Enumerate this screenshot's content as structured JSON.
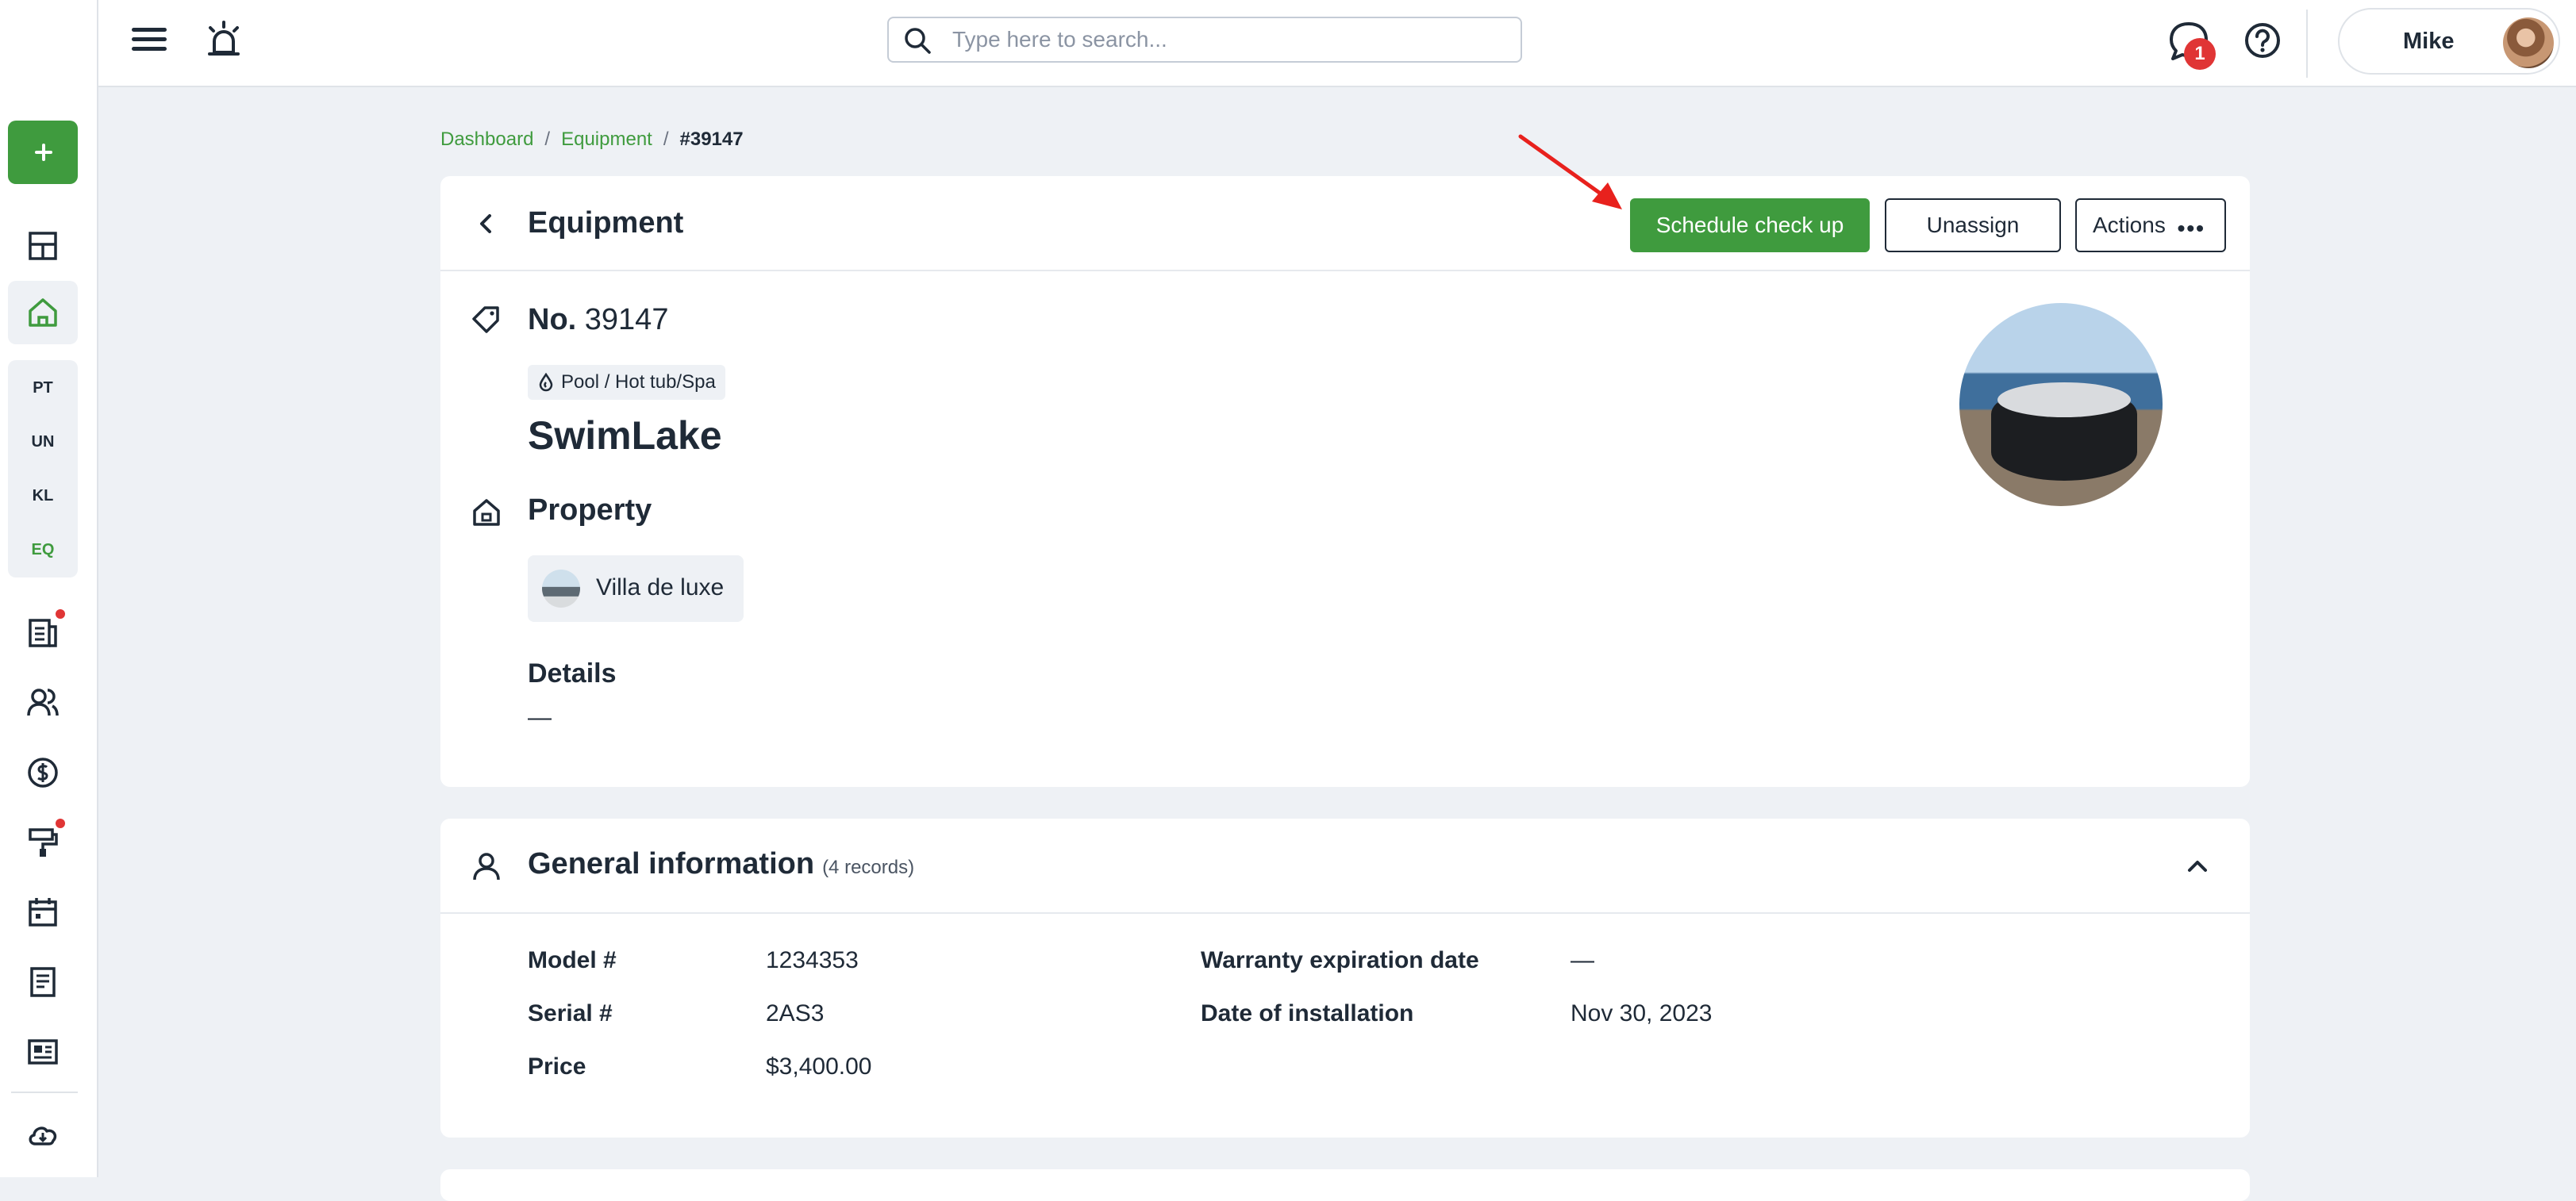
{
  "header": {
    "search_placeholder": "Type here to search...",
    "notification_count": "1",
    "user_name": "Mike"
  },
  "sidebar": {
    "sub_items": [
      "PT",
      "UN",
      "KL",
      "EQ"
    ],
    "active_sub_item": "EQ"
  },
  "breadcrumb": {
    "items": [
      "Dashboard",
      "Equipment"
    ],
    "current": "#39147"
  },
  "equipment_card": {
    "title": "Equipment",
    "schedule_label": "Schedule check up",
    "unassign_label": "Unassign",
    "actions_label": "Actions",
    "number_prefix": "No.",
    "number": "39147",
    "type": "Pool / Hot tub/Spa",
    "name": "SwimLake",
    "property_label": "Property",
    "property_name": "Villa de luxe",
    "details_label": "Details",
    "details_value": "—"
  },
  "general_info": {
    "title": "General information",
    "count": "(4 records)",
    "fields": [
      {
        "label": "Model #",
        "value": "1234353"
      },
      {
        "label": "Serial #",
        "value": "2AS3"
      },
      {
        "label": "Price",
        "value": "$3,400.00"
      },
      {
        "label": "Warranty expiration date",
        "value": "—"
      },
      {
        "label": "Date of installation",
        "value": "Nov 30, 2023"
      }
    ]
  },
  "colors": {
    "brand_green": "#3f9b3e",
    "badge_red": "#e03535",
    "annotation_red": "#e8211d",
    "text_dark": "#1f2a37",
    "page_bg": "#eef1f5"
  },
  "icons": [
    "hamburger-icon",
    "alarm-icon",
    "search-icon",
    "chat-icon",
    "help-icon",
    "plus-icon",
    "grid-icon",
    "home-icon",
    "report-icon",
    "users-icon",
    "dollar-icon",
    "paint-roller-icon",
    "calendar-icon",
    "document-icon",
    "news-icon",
    "cloud-icon",
    "chevron-left-icon",
    "tag-icon",
    "drop-icon",
    "house-icon",
    "person-icon",
    "chevron-up-icon",
    "more-dots-icon"
  ]
}
